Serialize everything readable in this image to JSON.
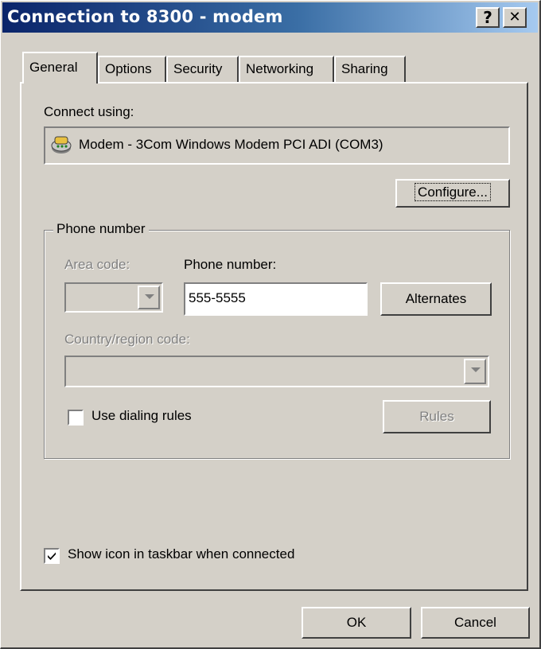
{
  "window": {
    "title": "Connection to 8300 - modem",
    "help_button": "?",
    "close_button": "✕"
  },
  "tabs": [
    {
      "label": "General",
      "active": true
    },
    {
      "label": "Options",
      "active": false
    },
    {
      "label": "Security",
      "active": false
    },
    {
      "label": "Networking",
      "active": false
    },
    {
      "label": "Sharing",
      "active": false
    }
  ],
  "general": {
    "connect_using_label": "Connect using:",
    "device_name": "Modem - 3Com Windows Modem PCI ADI (COM3)",
    "configure_button": "Configure...",
    "phone_group_title": "Phone number",
    "area_code_label": "Area code:",
    "phone_number_label": "Phone number:",
    "phone_number_value": "555-5555",
    "alternates_button": "Alternates",
    "country_label": "Country/region code:",
    "country_value": "",
    "use_dialing_rules_label": "Use dialing rules",
    "use_dialing_rules_checked": false,
    "rules_button": "Rules",
    "show_icon_label": "Show icon in taskbar when connected",
    "show_icon_checked": true
  },
  "footer": {
    "ok_button": "OK",
    "cancel_button": "Cancel"
  }
}
